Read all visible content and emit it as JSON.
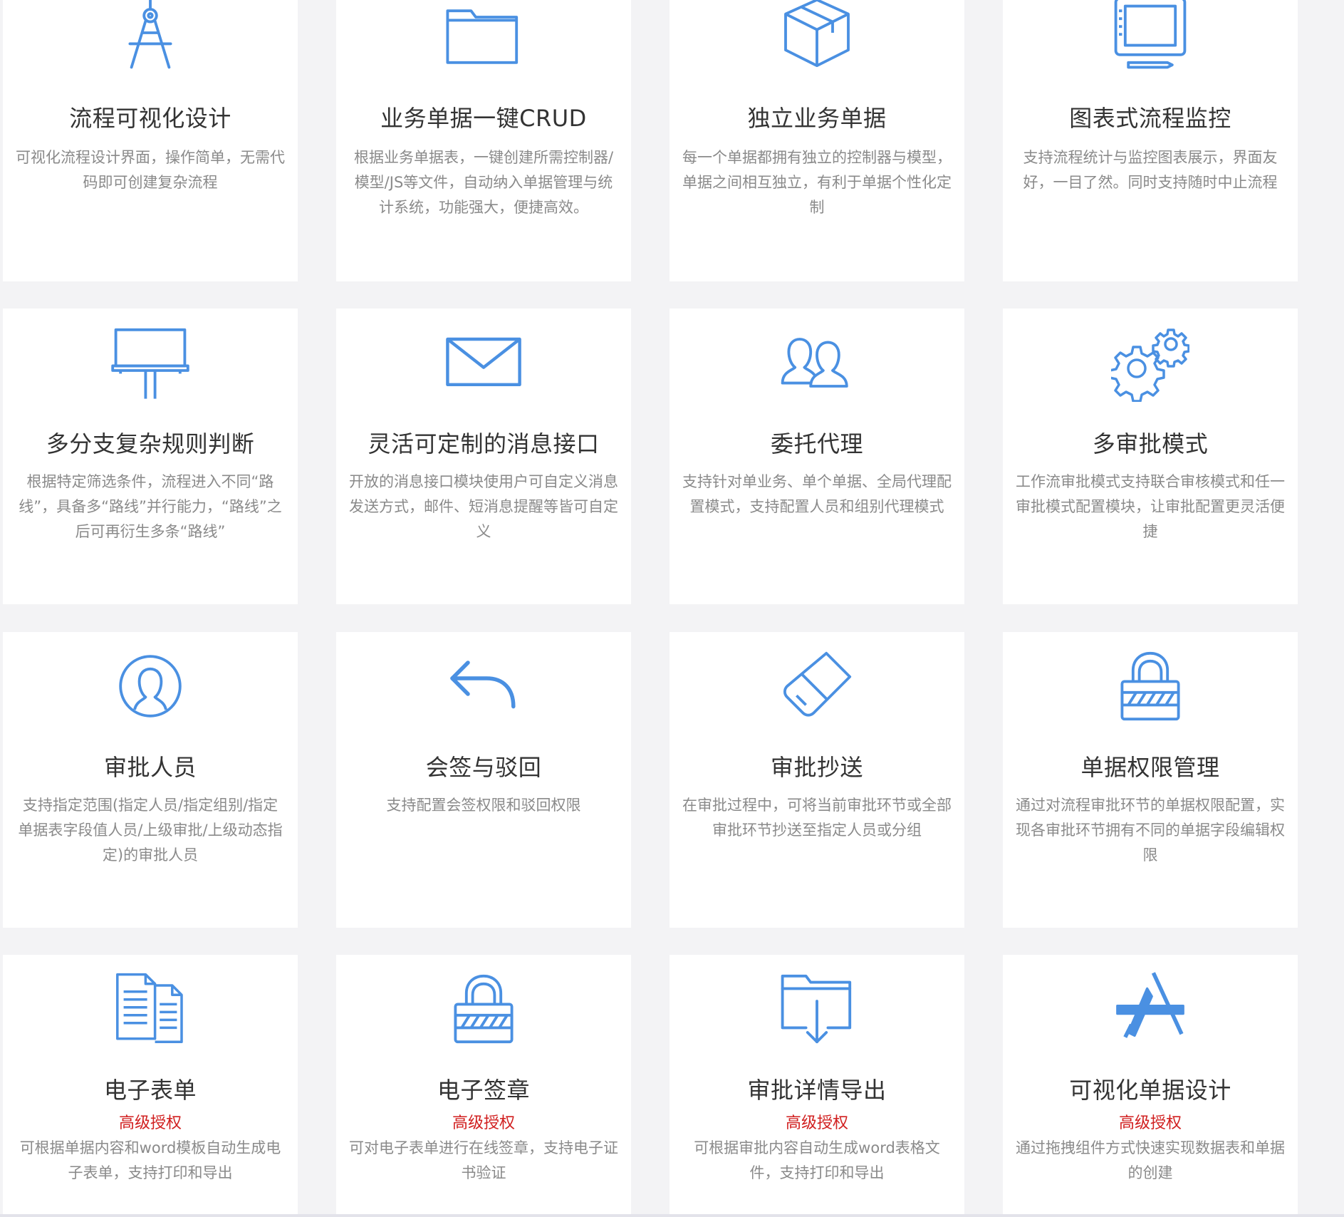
{
  "accent": "#4a90e2",
  "badge_color": "#d11f1f",
  "cards": [
    {
      "icon": "drafting-compass-icon",
      "title": "流程可视化设计",
      "badge": "",
      "desc": "可视化流程设计界面，操作简单，无需代码即可创建复杂流程"
    },
    {
      "icon": "folder-icon",
      "title": "业务单据一键CRUD",
      "badge": "",
      "desc": "根据业务单据表，一键创建所需控制器/模型/JS等文件，自动纳入单据管理与统计系统，功能强大，便捷高效。"
    },
    {
      "icon": "box-icon",
      "title": "独立业务单据",
      "badge": "",
      "desc": "每一个单据都拥有独立的控制器与模型，单据之间相互独立，有利于单据个性化定制"
    },
    {
      "icon": "monitor-icon",
      "title": "图表式流程监控",
      "badge": "",
      "desc": "支持流程统计与监控图表展示，界面友好，一目了然。同时支持随时中止流程"
    },
    {
      "icon": "billboard-icon",
      "title": "多分支复杂规则判断",
      "badge": "",
      "desc": "根据特定筛选条件，流程进入不同“路线”，具备多“路线”并行能力，“路线”之后可再衍生多条“路线”"
    },
    {
      "icon": "envelope-icon",
      "title": "灵活可定制的消息接口",
      "badge": "",
      "desc": "开放的消息接口模块使用户可自定义消息发送方式，邮件、短消息提醒等皆可自定义"
    },
    {
      "icon": "users-icon",
      "title": "委托代理",
      "badge": "",
      "desc": "支持针对单业务、单个单据、全局代理配置模式，支持配置人员和组别代理模式"
    },
    {
      "icon": "gears-icon",
      "title": "多审批模式",
      "badge": "",
      "desc": "工作流审批模式支持联合审核模式和任一审批模式配置模块，让审批配置更灵活便捷"
    },
    {
      "icon": "user-circle-icon",
      "title": "审批人员",
      "badge": "",
      "desc": "支持指定范围(指定人员/指定组别/指定单据表字段值人员/上级审批/上级动态指定)的审批人员"
    },
    {
      "icon": "reply-arrow-icon",
      "title": "会签与驳回",
      "badge": "",
      "desc": "支持配置会签权限和驳回权限"
    },
    {
      "icon": "eraser-icon",
      "title": "审批抄送",
      "badge": "",
      "desc": "在审批过程中，可将当前审批环节或全部审批环节抄送至指定人员或分组"
    },
    {
      "icon": "padlock-icon",
      "title": "单据权限管理",
      "badge": "",
      "desc": "通过对流程审批环节的单据权限配置，实现各审批环节拥有不同的单据字段编辑权限"
    },
    {
      "icon": "documents-icon",
      "title": "电子表单",
      "badge": "高级授权",
      "desc": "可根据单据内容和word模板自动生成电子表单，支持打印和导出"
    },
    {
      "icon": "padlock-icon",
      "title": "电子签章",
      "badge": "高级授权",
      "desc": "可对电子表单进行在线签章，支持电子证书验证"
    },
    {
      "icon": "folder-download-icon",
      "title": "审批详情导出",
      "badge": "高级授权",
      "desc": "可根据审批内容自动生成word表格文件，支持打印和导出"
    },
    {
      "icon": "app-store-icon",
      "title": "可视化单据设计",
      "badge": "高级授权",
      "desc": "通过拖拽组件方式快速实现数据表和单据的创建"
    }
  ]
}
